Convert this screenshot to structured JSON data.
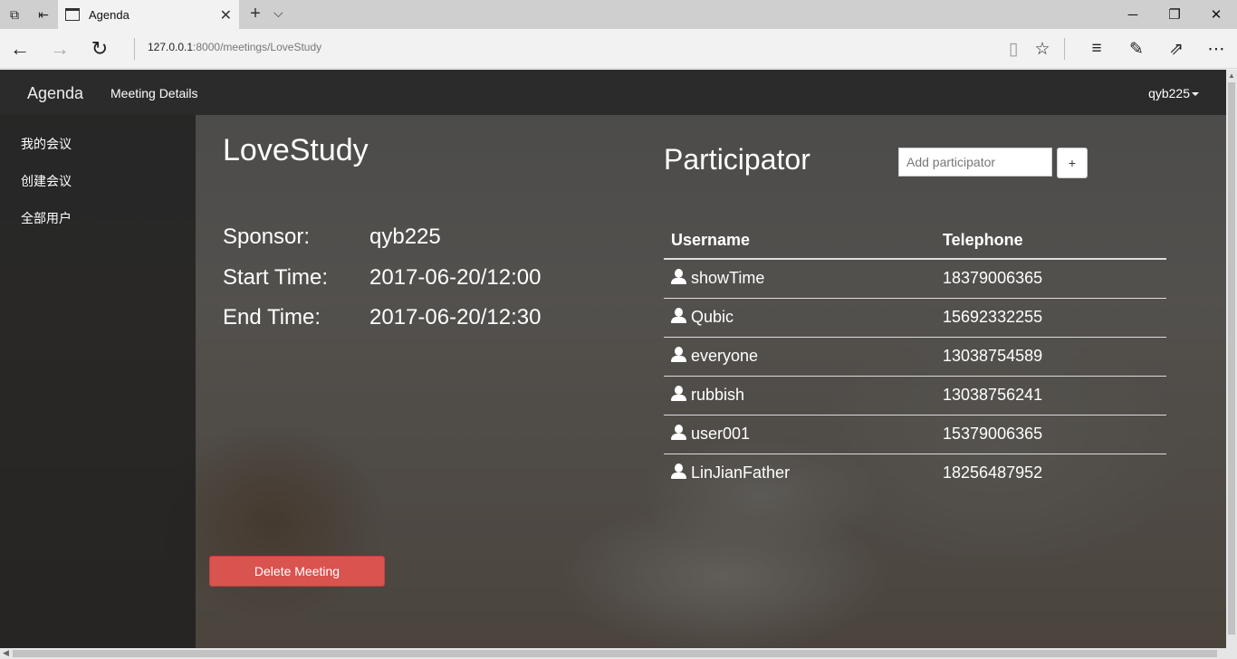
{
  "browser": {
    "tab_title": "Agenda",
    "url_host": "127.0.0.1",
    "url_path": ":8000/meetings/LoveStudy"
  },
  "navbar": {
    "brand": "Agenda",
    "link": "Meeting Details",
    "user": "qyb225"
  },
  "sidebar": {
    "items": [
      {
        "label": "我的会议"
      },
      {
        "label": "创建会议"
      },
      {
        "label": "全部用户"
      }
    ]
  },
  "meeting": {
    "title": "LoveStudy",
    "sponsor_label": "Sponsor:",
    "sponsor": "qyb225",
    "start_label": "Start Time:",
    "start": "2017-06-20/12:00",
    "end_label": "End Time:",
    "end": "2017-06-20/12:30",
    "delete_label": "Delete Meeting"
  },
  "participants": {
    "title": "Participator",
    "add_placeholder": "Add participator",
    "add_button": "+",
    "columns": [
      "Username",
      "Telephone"
    ],
    "rows": [
      {
        "username": "showTime",
        "telephone": "18379006365"
      },
      {
        "username": "Qubic",
        "telephone": "15692332255"
      },
      {
        "username": "everyone",
        "telephone": "13038754589"
      },
      {
        "username": "rubbish",
        "telephone": "13038756241"
      },
      {
        "username": "user001",
        "telephone": "15379006365"
      },
      {
        "username": "LinJianFather",
        "telephone": "18256487952"
      }
    ]
  },
  "colors": {
    "danger": "#d9534f",
    "navbar": "#2b2b2b"
  }
}
